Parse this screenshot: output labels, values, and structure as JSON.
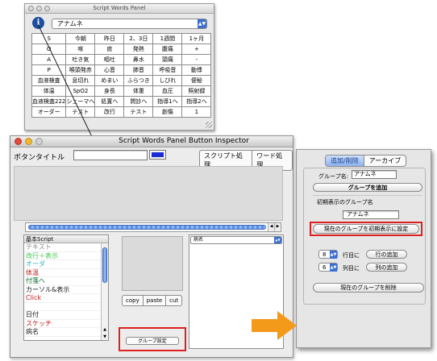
{
  "panel1": {
    "title": "Script Words Panel",
    "group_value": "アナムネ",
    "info_label": "i",
    "grid": [
      [
        "S",
        "今朝",
        "昨日",
        "2、3日",
        "1週間",
        "1ヶ月"
      ],
      [
        "O",
        "咳",
        "痰",
        "発熱",
        "腹痛",
        "+"
      ],
      [
        "A",
        "吐き気",
        "嘔吐",
        "鼻水",
        "頭痛",
        "-"
      ],
      [
        "P",
        "喉頭発赤",
        "心音",
        "肺音",
        "呼吸音",
        "動悸"
      ],
      [
        "血液検査",
        "息切れ",
        "めまい",
        "ふらつき",
        "しびれ",
        "便秘"
      ],
      [
        "体温",
        "SpO2",
        "身長",
        "体重",
        "血圧",
        "照射録"
      ],
      [
        "血液検査222",
        "シェーマへ",
        "処置へ",
        "問診へ",
        "指導1へ",
        "指導2へ"
      ],
      [
        "オーダー",
        "テスト",
        "改行",
        "テスト",
        "創傷",
        "1"
      ]
    ]
  },
  "panel2": {
    "title": "Script Words Panel Button Inspector",
    "button_title_label": "ボタンタイトル",
    "button_title_value": "",
    "script_tab": "スクリプト処理",
    "word_tab": "ワード処理",
    "list_header": "基本Script",
    "list_items": [
      {
        "text": "テキスト",
        "color": "#8a8a8a"
      },
      {
        "text": "改行＋表示",
        "color": "#44c64a"
      },
      {
        "text": "オーダ",
        "color": "#2fb8c4"
      },
      {
        "text": "体温",
        "color": "#c01818"
      },
      {
        "text": "付箋へ",
        "color": "#0d6f2f"
      },
      {
        "text": "カーソル&表示",
        "color": "#1a1a1a"
      },
      {
        "text": "Click",
        "color": "#c01818"
      },
      {
        "text": "",
        "color": "#000000"
      },
      {
        "text": "日付",
        "color": "#1a1a1a"
      },
      {
        "text": "スケッチ",
        "color": "#c01818"
      },
      {
        "text": "病名",
        "color": "#1a1a1a"
      }
    ],
    "copy_label": "copy",
    "paste_label": "paste",
    "cut_label": "cut",
    "group_settings_label": "グループ設定",
    "right_dropdown": "病名",
    "button_color": "#1b2bd6"
  },
  "panel3": {
    "tab_add_delete": "追加/削除",
    "tab_archive": "アーカイブ",
    "group_name_label": "グループ名:",
    "group_name_value": "アナムネ",
    "add_group_label": "グループを追加",
    "initial_group_heading": "初期表示のグループ名",
    "initial_group_value": "アナムネ",
    "set_initial_label": "現在のグループを初期表示に設定",
    "rows_value": "8",
    "rows_label": "行目に",
    "add_row_label": "行の追加",
    "cols_value": "6",
    "cols_label": "列目に",
    "add_col_label": "列の追加",
    "delete_group_label": "現在のグループを削除"
  },
  "colors": {
    "highlight_red": "#e02020",
    "arrow_orange": "#f39a1a",
    "accent_blue": "#3a6fd0"
  }
}
